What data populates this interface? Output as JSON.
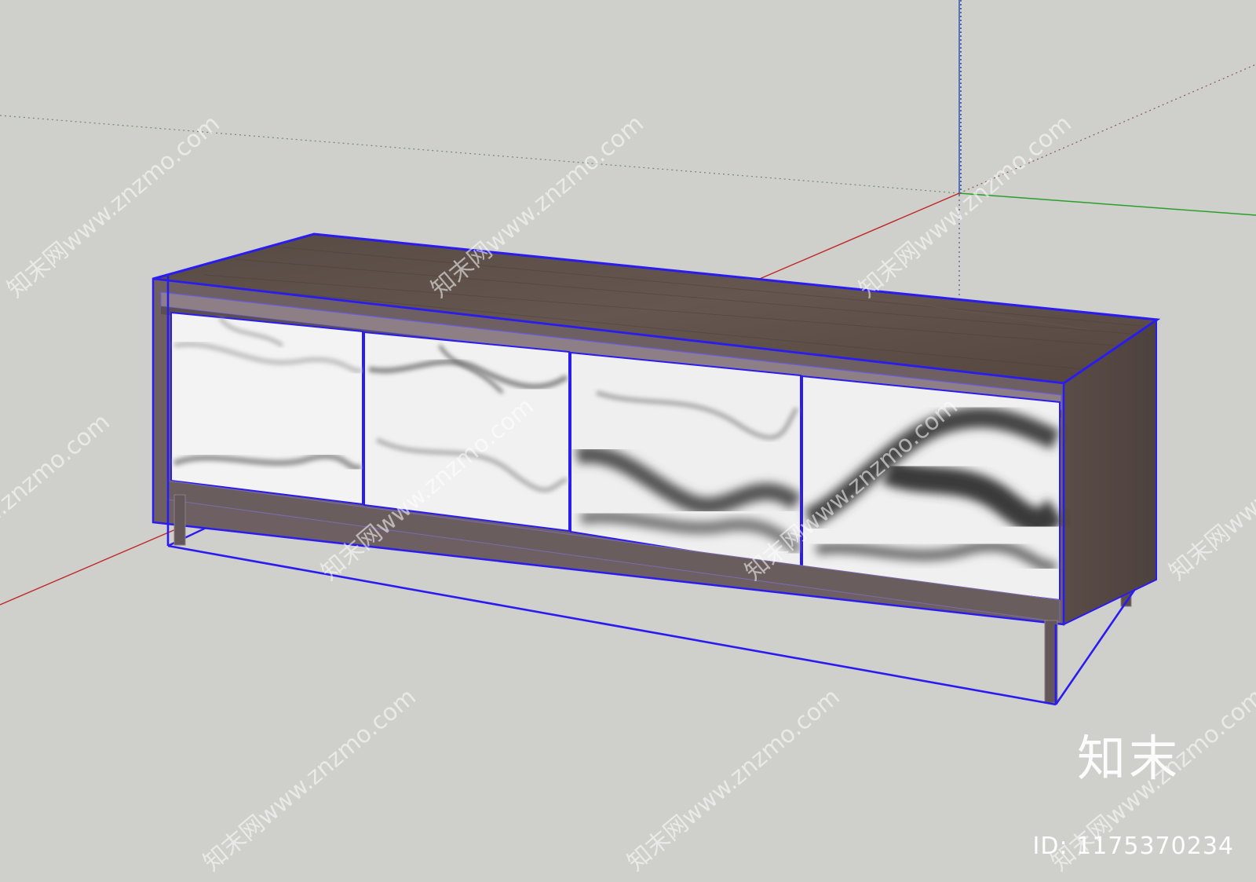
{
  "scene": {
    "background": "#cfcfcb",
    "axis_colors": {
      "red": "#c02828",
      "green": "#2aa02a",
      "blue": "#2b4aa8"
    },
    "selection_color": "#2a1cf0",
    "wood_color": "#5e514a",
    "frame_color": "#6e6062",
    "marble_base": "#f2f2f2",
    "marble_vein": "#6a6a6a"
  },
  "object": {
    "name": "cabinet",
    "door_count": 4
  },
  "watermark": {
    "site_text": "知末网www.znzmo.com",
    "brand": "知末",
    "id_label": "ID: 1175370234"
  }
}
